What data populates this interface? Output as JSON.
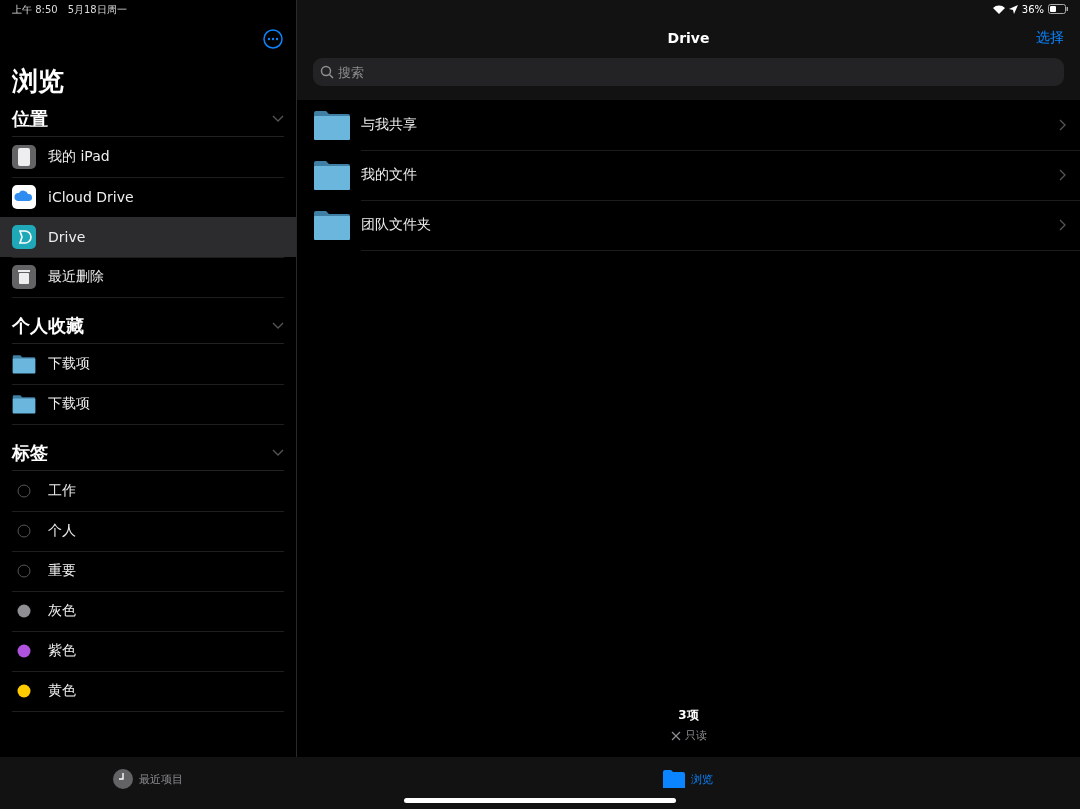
{
  "status_bar": {
    "time": "上午 8:50",
    "date": "5月18日周一",
    "battery": "36%"
  },
  "sidebar": {
    "title": "浏览",
    "sections": [
      {
        "title": "位置",
        "expanded": true,
        "items": [
          {
            "kind": "device",
            "label": "我的 iPad",
            "selected": false
          },
          {
            "kind": "cloud",
            "label": "iCloud Drive",
            "selected": false
          },
          {
            "kind": "drive",
            "label": "Drive",
            "selected": true
          },
          {
            "kind": "trash",
            "label": "最近删除",
            "selected": false
          }
        ]
      },
      {
        "title": "个人收藏",
        "expanded": true,
        "items": [
          {
            "kind": "folder",
            "label": "下载项",
            "selected": false
          },
          {
            "kind": "folder",
            "label": "下载项",
            "selected": false
          }
        ]
      },
      {
        "title": "标签",
        "expanded": true,
        "items": [
          {
            "kind": "tag",
            "label": "工作",
            "selected": false
          },
          {
            "kind": "tag",
            "label": "个人",
            "selected": false
          },
          {
            "kind": "tag",
            "label": "重要",
            "selected": false
          },
          {
            "kind": "tag",
            "label": "灰色",
            "selected": false,
            "color": "#8e8e93"
          },
          {
            "kind": "tag",
            "label": "紫色",
            "selected": false,
            "color": "#af52de"
          },
          {
            "kind": "tag",
            "label": "黄色",
            "selected": false,
            "color": "#ffcc00"
          }
        ]
      }
    ]
  },
  "content": {
    "title": "Drive",
    "action": "选择",
    "search": {
      "placeholder": "搜索"
    },
    "folders": [
      {
        "name": "与我共享"
      },
      {
        "name": "我的文件"
      },
      {
        "name": "团队文件夹"
      }
    ],
    "footer": {
      "count": "3项",
      "note": "只读"
    }
  },
  "tab_bar": [
    {
      "kind": "recent",
      "label": "最近项目",
      "selected": false
    },
    {
      "kind": "browse",
      "label": "浏览",
      "selected": true
    }
  ]
}
